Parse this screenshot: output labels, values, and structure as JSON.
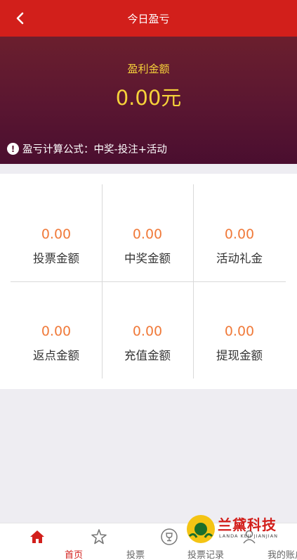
{
  "header": {
    "title": "今日盈亏"
  },
  "summary": {
    "label": "盈利金额",
    "amount": "0.00元",
    "formula": "盈亏计算公式：中奖-投注+活动"
  },
  "stats": [
    {
      "value": "0.00",
      "label": "投票金额"
    },
    {
      "value": "0.00",
      "label": "中奖金额"
    },
    {
      "value": "0.00",
      "label": "活动礼金"
    },
    {
      "value": "0.00",
      "label": "返点金额"
    },
    {
      "value": "0.00",
      "label": "充值金额"
    },
    {
      "value": "0.00",
      "label": "提现金额"
    }
  ],
  "tabbar": {
    "items": [
      {
        "label": "首页",
        "icon": "home-icon",
        "active": true
      },
      {
        "label": "投票",
        "icon": "star-icon",
        "active": false
      },
      {
        "label": "投票记录",
        "icon": "trophy-icon",
        "active": false
      },
      {
        "label": "我的账户",
        "icon": "user-icon",
        "active": false
      }
    ]
  },
  "watermark": {
    "text": "兰黛科技",
    "subtext": "LANDA KEJI JIANJIAN"
  },
  "colors": {
    "header": "#d21f1b",
    "hero_top": "#6b1f2e",
    "hero_bottom": "#4a0e2f",
    "amount": "#f6d23a",
    "stat_value": "#f07a3a"
  }
}
